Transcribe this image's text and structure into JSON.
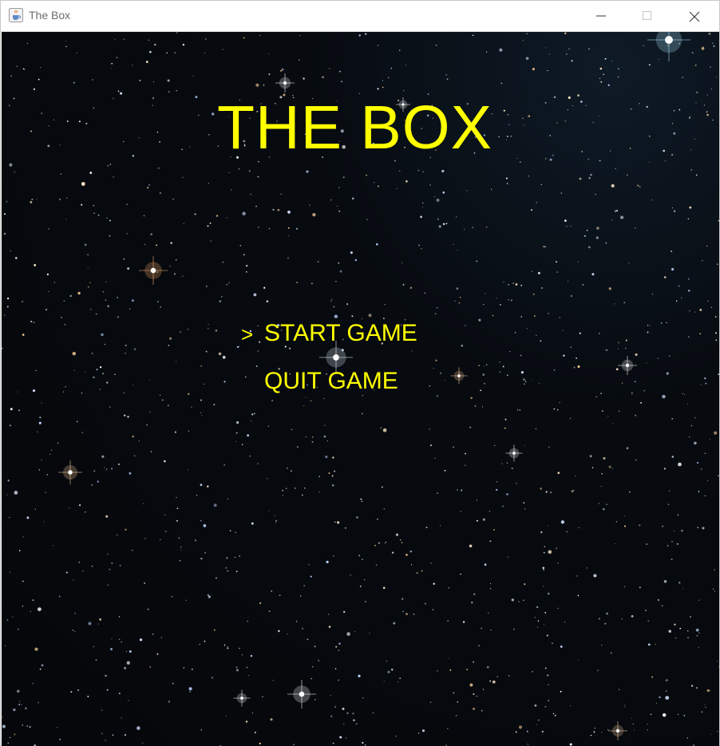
{
  "window": {
    "title": "The Box",
    "icon": "java-cup-icon",
    "controls": [
      "minimize-icon",
      "maximize-icon",
      "close-icon"
    ]
  },
  "game": {
    "title": "THE BOX",
    "selection_marker": ">",
    "menu": [
      {
        "label": "START GAME",
        "selected": true
      },
      {
        "label": "QUIT GAME",
        "selected": false
      }
    ],
    "background": "starfield",
    "text_color": "#ffff00"
  }
}
